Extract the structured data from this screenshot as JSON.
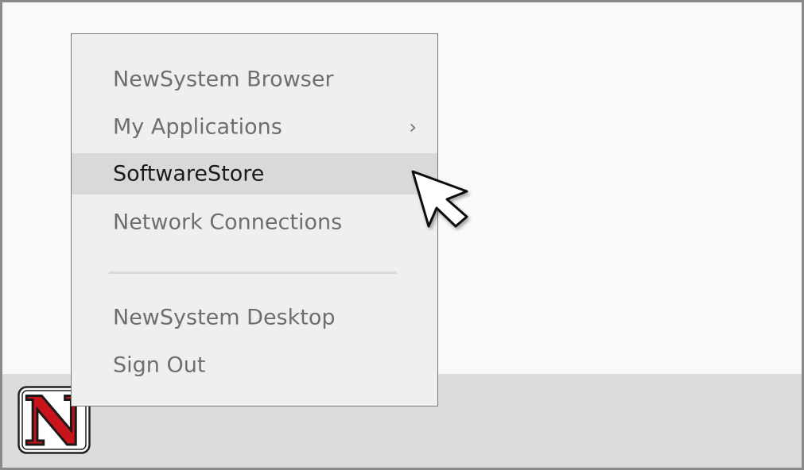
{
  "start_menu": {
    "items": [
      {
        "label": "NewSystem Browser"
      },
      {
        "label": "My Applications",
        "submenu_arrow": "›"
      },
      {
        "label": "SoftwareStore"
      },
      {
        "label": "Network Connections"
      },
      {
        "label": "NewSystem Desktop"
      },
      {
        "label": "Sign Out"
      }
    ],
    "highlighted_item": "SoftwareStore"
  },
  "taskbar": {
    "start_button_icon": "newsystem-logo-icon",
    "logo_letter": "N",
    "logo_color": "#c8141a"
  },
  "colors": {
    "menu_background": "#efefef",
    "menu_highlight": "#d9d9d9",
    "menu_text": "#6e6e6e",
    "menu_text_active": "#1a1a1a",
    "taskbar": "#dcdcdc",
    "desktop": "#f9f9f9"
  },
  "cursor_icon": "arrow-pointer-icon"
}
